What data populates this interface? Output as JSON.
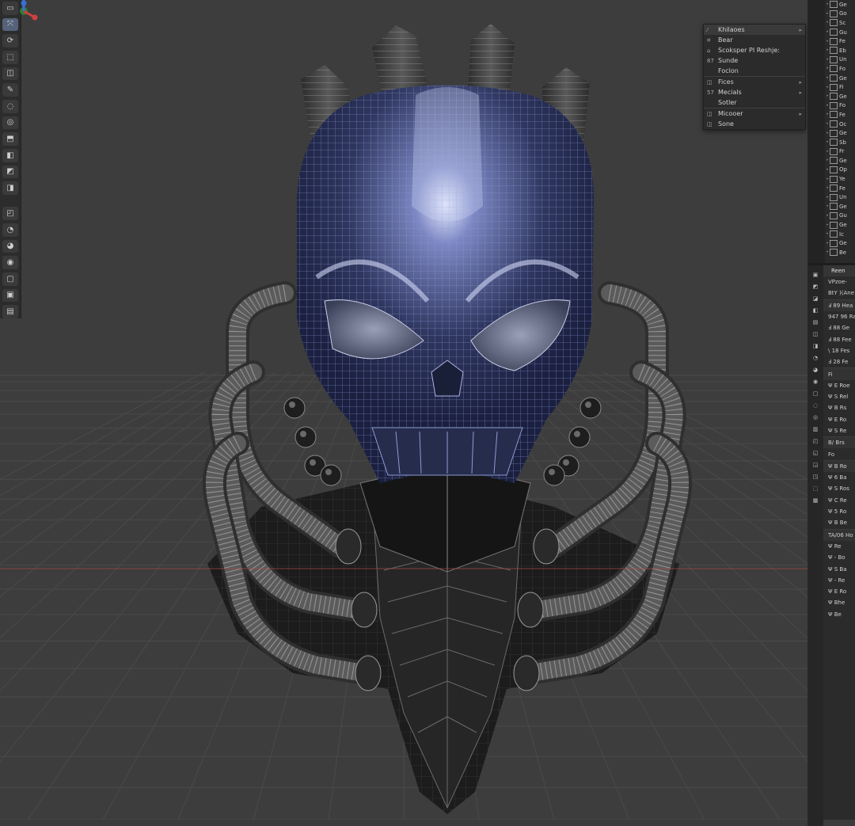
{
  "toolbar": {
    "tools": [
      {
        "name": "tool-select-icon",
        "glyph": "▭"
      },
      {
        "name": "tool-move-icon",
        "glyph": "⤧",
        "active": true
      },
      {
        "name": "tool-rotate-icon",
        "glyph": "⟳"
      },
      {
        "name": "tool-scale-icon",
        "glyph": "⬚"
      },
      {
        "name": "tool-transform-icon",
        "glyph": "◫"
      },
      {
        "name": "tool-annotate-icon",
        "glyph": "✎"
      },
      {
        "name": "tool-measure-icon",
        "glyph": "◌"
      },
      {
        "name": "tool-add-cube-icon",
        "glyph": "◎"
      },
      {
        "name": "tool-extrude-icon",
        "glyph": "⬒"
      },
      {
        "name": "tool-inset-icon",
        "glyph": "◧"
      },
      {
        "name": "tool-bevel-icon",
        "glyph": "◩"
      },
      {
        "name": "tool-loopcut-icon",
        "glyph": "◨"
      },
      {
        "name": "tool-knife-icon",
        "glyph": "◰"
      },
      {
        "name": "tool-polybuild-icon",
        "glyph": "◔"
      },
      {
        "name": "tool-spin-icon",
        "glyph": "◕"
      },
      {
        "name": "tool-smooth-icon",
        "glyph": "◉"
      },
      {
        "name": "tool-edge-slide-icon",
        "glyph": "▢"
      },
      {
        "name": "tool-shrink-icon",
        "glyph": "▣"
      },
      {
        "name": "tool-shear-icon",
        "glyph": "▤"
      }
    ]
  },
  "context_menu": {
    "items": [
      {
        "icon": "⁄",
        "label": "Khilaoes",
        "arrow": "▸",
        "header": true
      },
      {
        "icon": "¤",
        "label": "Bear"
      },
      {
        "icon": "⌂",
        "label": "Scoksper  PI Reshje:"
      },
      {
        "icon": "87",
        "label": "Sunde"
      },
      {
        "icon": "",
        "label": "Foclon"
      },
      {
        "icon": "◫",
        "label": "Fices",
        "arrow": "▸",
        "sep": true
      },
      {
        "icon": "57",
        "label": "Mecials",
        "arrow": "▸"
      },
      {
        "icon": "",
        "label": "Sotler"
      },
      {
        "icon": "◫",
        "label": "Micooer",
        "arrow": "▸",
        "sep": true
      },
      {
        "icon": "◫",
        "label": "Sone"
      }
    ]
  },
  "outliner": {
    "rows": [
      "Ge",
      "Go",
      "Sc",
      "Gu",
      "Fe",
      "Eb",
      "Un",
      "Fo",
      "Ge",
      "Fi",
      "Ge",
      "Fo",
      "Fe",
      "Oc",
      "Ge",
      "Sb",
      "Fr",
      "Ge",
      "Op",
      "Ye",
      "Fe",
      "Un",
      "Ge",
      "Gu",
      "Ge",
      "Ic",
      "Ge",
      "Be"
    ]
  },
  "properties": {
    "header": "Reen",
    "rows": [
      {
        "label": "VPzoe-"
      },
      {
        "label": "BtY  )(Ane"
      },
      {
        "label": "Ⅎ 89 Hea",
        "boxed": true
      },
      {
        "label": "947 96 Ra"
      },
      {
        "label": "Ⅎ 88 Ge"
      },
      {
        "label": "Ⅎ 88 Fee"
      },
      {
        "label": "\\ 18 Fes"
      },
      {
        "label": "Ⅎ 28 Fe"
      },
      {
        "label": "Fi",
        "boxed": true
      },
      {
        "label": "Ψ E Roe"
      },
      {
        "label": "Ψ S Rel"
      },
      {
        "label": "Ψ B Rs"
      },
      {
        "label": "Ψ E Ro"
      },
      {
        "label": "Ψ S Re"
      },
      {
        "label": "B/ Brs",
        "boxed": true
      },
      {
        "label": "Fo"
      },
      {
        "label": "Ψ B Ro",
        "boxed": true
      },
      {
        "label": "Ψ 6 Ba"
      },
      {
        "label": "Ψ S Ros"
      },
      {
        "label": "Ψ C Re"
      },
      {
        "label": "Ψ 5 Ro"
      },
      {
        "label": "Ψ B Be"
      },
      {
        "label": "TA/06 Ho",
        "boxed": true
      },
      {
        "label": "Ψ  Re"
      },
      {
        "label": "Ψ - Bo"
      },
      {
        "label": "Ψ S Ba"
      },
      {
        "label": "Ψ - Re"
      },
      {
        "label": "Ψ E Ro"
      },
      {
        "label": "Ψ Bhe"
      },
      {
        "label": "Ψ Be"
      }
    ]
  },
  "colors": {
    "viewport_bg": "#3d3d3d",
    "grid": "#4a4a4a",
    "x_axis": "#b04848",
    "skull_face": "#2c3356",
    "skull_wire": "#8f9bd2",
    "armor": "#1c1c1c",
    "armor_wire": "#7a7a7a",
    "tube": "#3a3a3a",
    "tube_wire": "#a8a8a8"
  }
}
